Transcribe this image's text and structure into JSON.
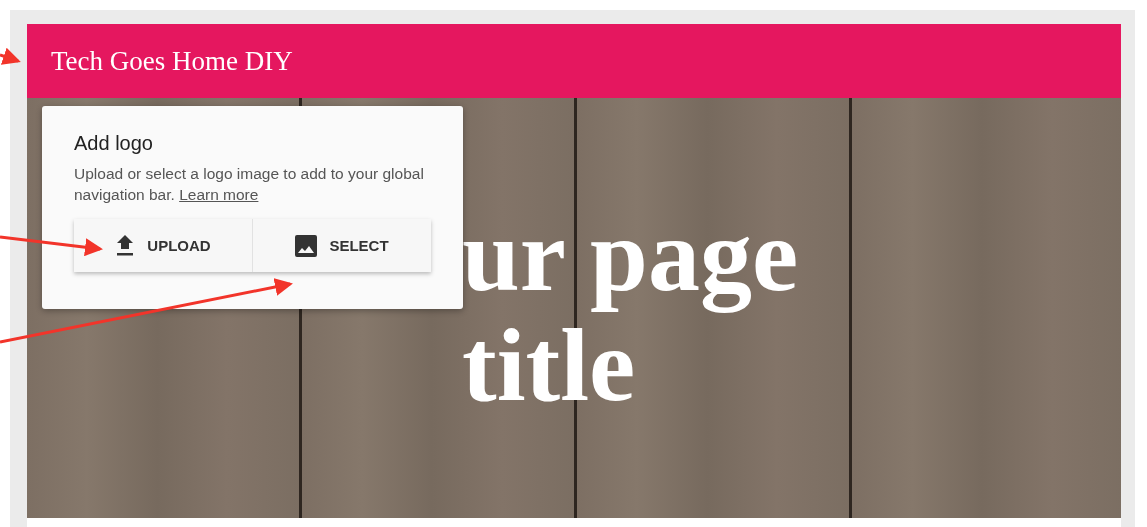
{
  "header": {
    "site_title": "Tech Goes Home DIY"
  },
  "hero": {
    "title": "ur page title"
  },
  "logo_popup": {
    "heading": "Add logo",
    "description": "Upload or select a logo image to add to your global navigation bar.",
    "link": "Learn more",
    "buttons": [
      {
        "kind": "upload",
        "label": "UPLOAD"
      },
      {
        "kind": "select",
        "label": "SELECT"
      }
    ]
  }
}
